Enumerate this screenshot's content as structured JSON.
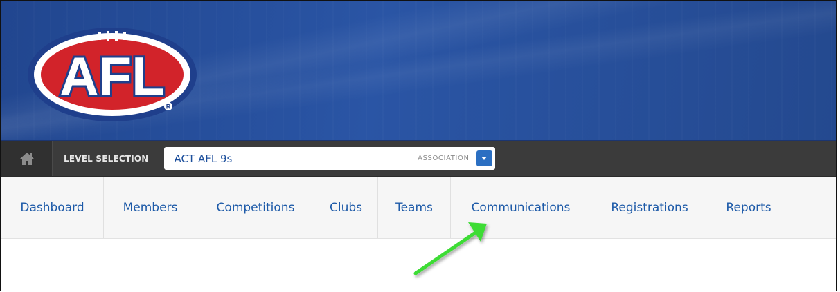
{
  "header": {
    "logo_text": "AFL",
    "logo_colors": {
      "outer_blue": "#1f3f8c",
      "ring_white": "#ffffff",
      "oval_red": "#d2232a"
    },
    "banner_color": "#2a52a0"
  },
  "level_bar": {
    "home_icon": "home-icon",
    "label": "LEVEL SELECTION",
    "selected_value": "ACT AFL 9s",
    "level_type": "ASSOCIATION",
    "dropdown_icon": "chevron-down-icon"
  },
  "nav": {
    "items": [
      {
        "label": "Dashboard"
      },
      {
        "label": "Members"
      },
      {
        "label": "Competitions"
      },
      {
        "label": "Clubs"
      },
      {
        "label": "Teams"
      },
      {
        "label": "Communications"
      },
      {
        "label": "Registrations"
      },
      {
        "label": "Reports"
      }
    ],
    "link_color": "#1d5aa8"
  },
  "annotation": {
    "arrow_icon": "pointer-arrow-icon",
    "arrow_color": "#3ddc36"
  }
}
